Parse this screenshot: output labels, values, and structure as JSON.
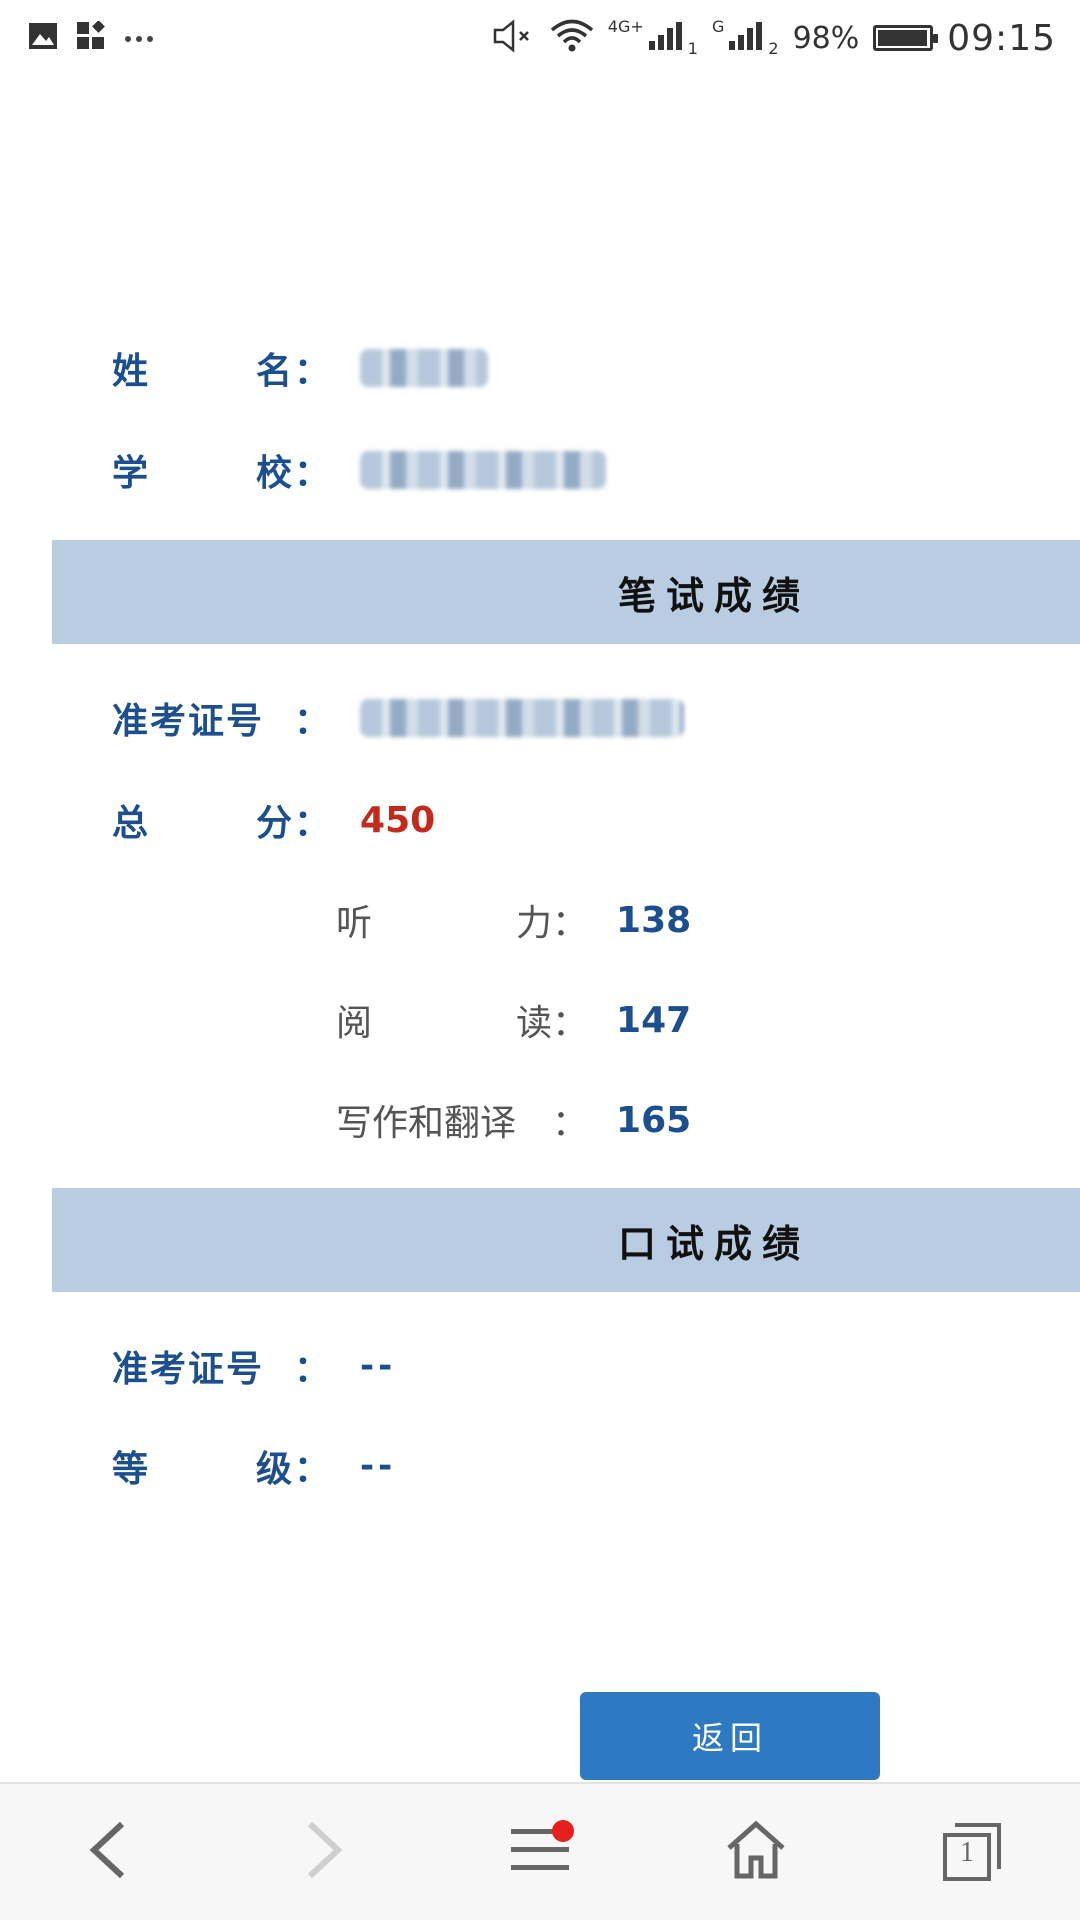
{
  "status_bar": {
    "network_small": "4G+",
    "sim1_index": "1",
    "network2": "G",
    "sim2_index": "2",
    "battery": "98%",
    "battery_level": 0.98,
    "time": "09:15",
    "icons": [
      "image-icon",
      "apps-icon",
      "more-icon",
      "mute-icon",
      "wifi-icon",
      "signal-icon",
      "signal-icon",
      "battery-icon"
    ]
  },
  "personal": {
    "name_label_1": "姓",
    "name_label_2": "名",
    "school_label_1": "学",
    "school_label_2": "校",
    "colon": "："
  },
  "written": {
    "section_title": "笔试成绩",
    "ticket_label": "准考证号",
    "total_label_1": "总",
    "total_label_2": "分",
    "total_value": "450",
    "listening_label_1": "听",
    "listening_label_2": "力",
    "listening_value": "138",
    "reading_label_1": "阅",
    "reading_label_2": "读",
    "reading_value": "147",
    "writing_label": "写作和翻译",
    "writing_value": "165"
  },
  "oral": {
    "section_title": "口试成绩",
    "ticket_label": "准考证号",
    "ticket_value": "--",
    "grade_label_1": "等",
    "grade_label_2": "级",
    "grade_value": "--"
  },
  "back_button": "返回",
  "browser_bar": {
    "tab_count": "1",
    "icons": [
      "back-arrow-icon",
      "forward-arrow-icon",
      "menu-icon",
      "home-icon",
      "tabs-icon"
    ],
    "accent": "#e8201d"
  }
}
